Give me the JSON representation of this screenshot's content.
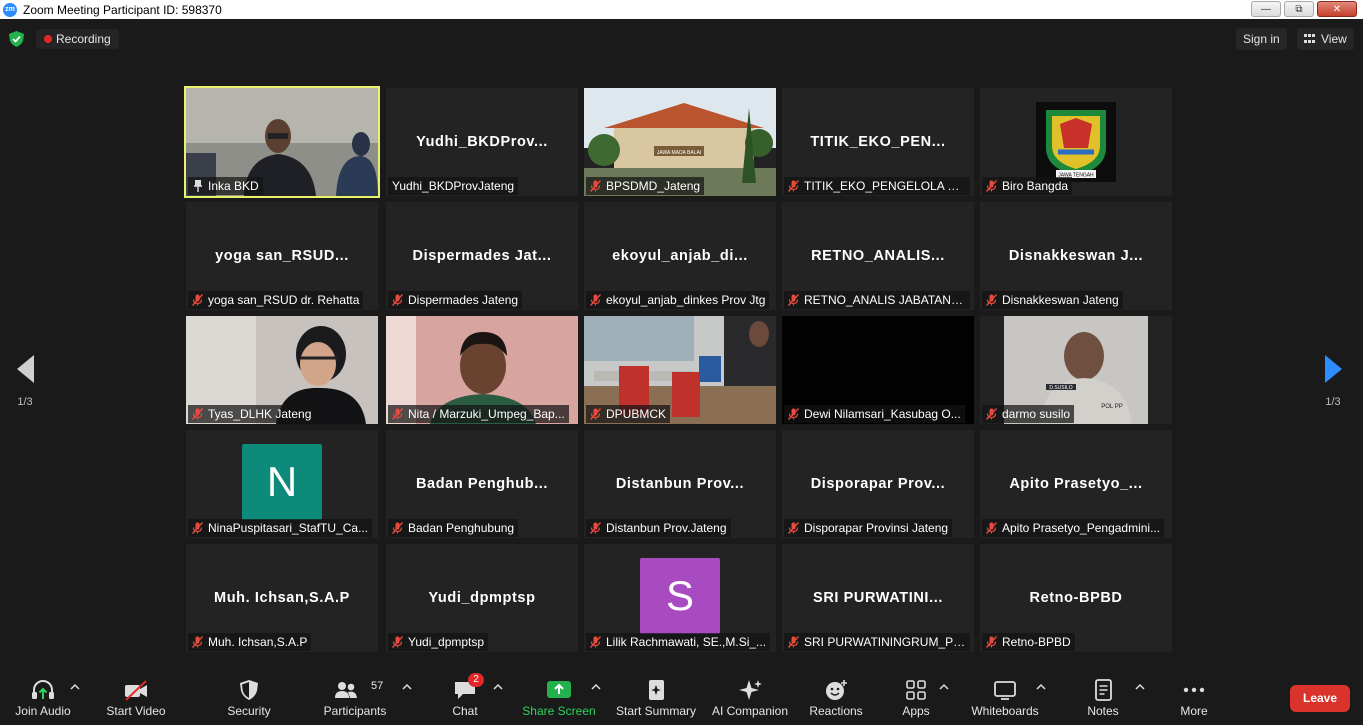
{
  "window": {
    "title": "Zoom Meeting Participant ID: 598370",
    "app_icon_text": "zm"
  },
  "topbar": {
    "recording": "Recording",
    "sign_in": "Sign in",
    "view": "View"
  },
  "paging": {
    "left": "1/3",
    "right": "1/3"
  },
  "tiles": [
    {
      "big": "",
      "label": "Inka BKD"
    },
    {
      "big": "Yudhi_BKDProv...",
      "label": "Yudhi_BKDProvJateng"
    },
    {
      "big": "",
      "label": "BPSDMD_Jateng",
      "sign": "JAWA MADA BALAI"
    },
    {
      "big": "TITIK_EKO_PEN...",
      "label": "TITIK_EKO_PENGELOLA KE..."
    },
    {
      "big": "",
      "label": "Biro Bangda",
      "logo_text": "JAWA TENGAH"
    },
    {
      "big": "yoga san_RSUD...",
      "label": "yoga san_RSUD dr. Rehatta"
    },
    {
      "big": "Dispermades Jat...",
      "label": "Dispermades Jateng"
    },
    {
      "big": "ekoyul_anjab_di...",
      "label": "ekoyul_anjab_dinkes Prov Jtg"
    },
    {
      "big": "RETNO_ANALIS...",
      "label": "RETNO_ANALIS JABATAN_..."
    },
    {
      "big": "Disnakkeswan J...",
      "label": "Disnakkeswan Jateng"
    },
    {
      "big": "",
      "label": "Tyas_DLHK Jateng"
    },
    {
      "big": "",
      "label": "Nita / Marzuki_Umpeg_Bap..."
    },
    {
      "big": "",
      "label": "DPUBMCK"
    },
    {
      "big": "",
      "label": "Dewi Nilamsari_Kasubag O..."
    },
    {
      "big": "",
      "label": "darmo susilo",
      "badge": "D.SUSILO",
      "badge2": "POL PP"
    },
    {
      "big": "",
      "label": "NinaPuspitasari_StafTU_Ca...",
      "avatar": "N",
      "avatar_color": "#0e8a7a"
    },
    {
      "big": "Badan Penghub...",
      "label": "Badan Penghubung"
    },
    {
      "big": "Distanbun Prov...",
      "label": "Distanbun Prov.Jateng"
    },
    {
      "big": "Disporapar Prov...",
      "label": "Disporapar Provinsi Jateng"
    },
    {
      "big": "Apito Prasetyo_...",
      "label": "Apito Prasetyo_Pengadmini..."
    },
    {
      "big": "Muh. Ichsan,S.A.P",
      "label": "Muh. Ichsan,S.A.P"
    },
    {
      "big": "Yudi_dpmptsp",
      "label": "Yudi_dpmptsp"
    },
    {
      "big": "",
      "label": "Lilik Rachmawati, SE.,M.Si_...",
      "avatar": "S",
      "avatar_color": "#a94bc0"
    },
    {
      "big": "SRI PURWATINI...",
      "label": "SRI PURWATININGRUM_PE..."
    },
    {
      "big": "Retno-BPBD",
      "label": "Retno-BPBD"
    }
  ],
  "toolbar": {
    "join_audio": "Join Audio",
    "start_video": "Start Video",
    "security": "Security",
    "participants": "Participants",
    "participants_count": "57",
    "chat": "Chat",
    "chat_badge": "2",
    "share_screen": "Share Screen",
    "start_summary": "Start Summary",
    "ai_companion": "AI Companion",
    "reactions": "Reactions",
    "apps": "Apps",
    "whiteboards": "Whiteboards",
    "notes": "Notes",
    "more": "More",
    "leave": "Leave"
  },
  "colors": {
    "accent": "#2d8cff",
    "active_speaker": "#e8f26b",
    "leave": "#d9332b",
    "share": "#2dd35c",
    "record": "#e02828"
  }
}
